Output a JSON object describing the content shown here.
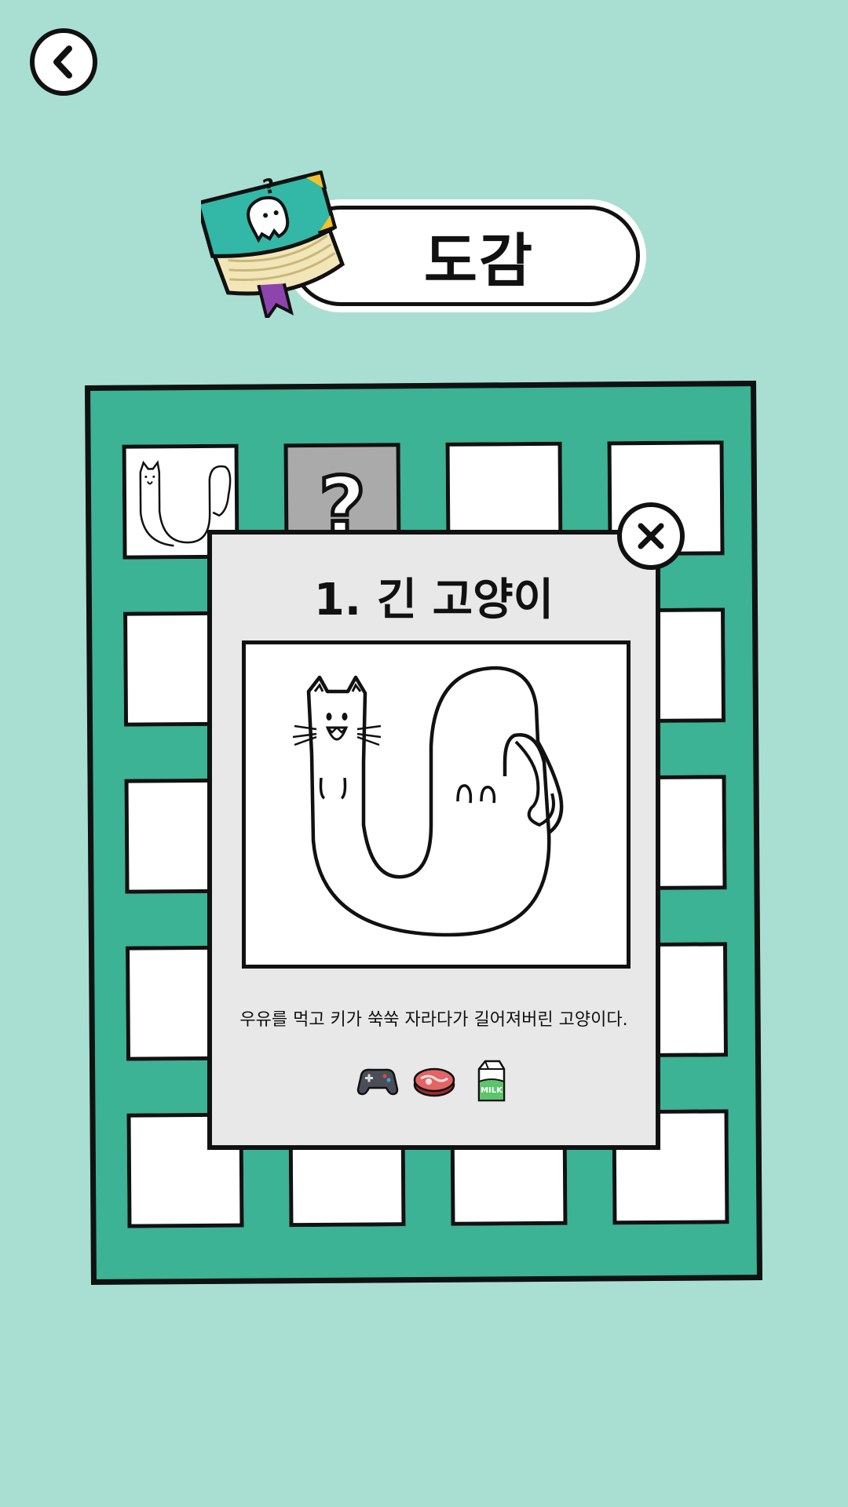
{
  "header": {
    "title": "도감"
  },
  "board": {
    "cells": [
      {
        "state": "discovered",
        "icon": "long-cat-thumbnail"
      },
      {
        "state": "unknown",
        "icon": "question-mark-icon"
      },
      {
        "state": "empty"
      },
      {
        "state": "empty"
      },
      {
        "state": "empty"
      },
      {
        "state": "empty"
      },
      {
        "state": "empty"
      },
      {
        "state": "empty"
      },
      {
        "state": "empty"
      },
      {
        "state": "empty"
      },
      {
        "state": "empty"
      },
      {
        "state": "empty"
      },
      {
        "state": "empty"
      },
      {
        "state": "empty"
      },
      {
        "state": "empty"
      },
      {
        "state": "empty"
      },
      {
        "state": "empty"
      },
      {
        "state": "empty"
      },
      {
        "state": "empty"
      },
      {
        "state": "empty"
      }
    ]
  },
  "modal": {
    "title": "1. 긴 고양이",
    "description": "우유를 먹고 키가 쑥쑥 자라다가 길어져버린 고양이다.",
    "hints": [
      {
        "icon": "game-controller-icon"
      },
      {
        "icon": "meat-icon"
      },
      {
        "icon": "milk-carton-icon",
        "label": "MILK"
      }
    ]
  },
  "colors": {
    "background": "#a9dfd2",
    "board": "#3bb394",
    "modal": "#e8e8e8",
    "book": "#33b7a6"
  }
}
